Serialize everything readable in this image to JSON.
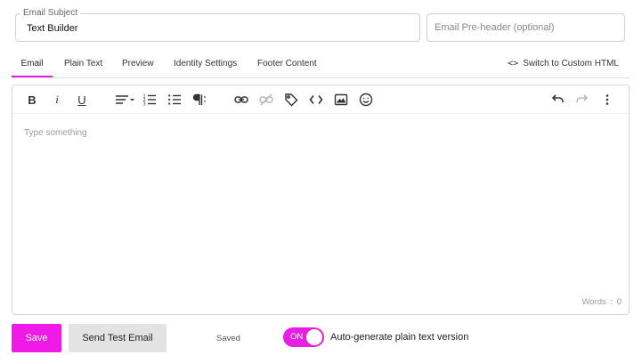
{
  "subject": {
    "legend": "Email Subject",
    "value": "Text Builder"
  },
  "preheader": {
    "placeholder": "Email Pre-header (optional)",
    "value": ""
  },
  "tabs": [
    {
      "label": "Email",
      "active": true
    },
    {
      "label": "Plain Text",
      "active": false
    },
    {
      "label": "Preview",
      "active": false
    },
    {
      "label": "Identity Settings",
      "active": false
    },
    {
      "label": "Footer Content",
      "active": false
    }
  ],
  "switch_html": {
    "icon": "code-icon",
    "label": "Switch to Custom HTML"
  },
  "toolbar": {
    "icons": [
      "bold-icon",
      "italic-icon",
      "underline-icon",
      "align-icon",
      "ordered-list-icon",
      "bullet-list-icon",
      "paragraph-icon",
      "link-icon",
      "unlink-icon",
      "tag-icon",
      "code-icon",
      "image-icon",
      "emoji-icon",
      "undo-icon",
      "redo-icon",
      "more-vertical-icon"
    ],
    "bold": "B",
    "italic": "i",
    "underline": "U"
  },
  "editor": {
    "placeholder": "Type something",
    "words_label": "Words",
    "words_count": "0"
  },
  "footer": {
    "save_label": "Save",
    "test_label": "Send Test Email",
    "status": "Saved",
    "toggle_label": "ON",
    "autogen_label": "Auto-generate plain text version"
  },
  "colors": {
    "accent": "#e91ee4",
    "save_bg": "#f01ae8",
    "secondary_bg": "#e3e3e3"
  }
}
